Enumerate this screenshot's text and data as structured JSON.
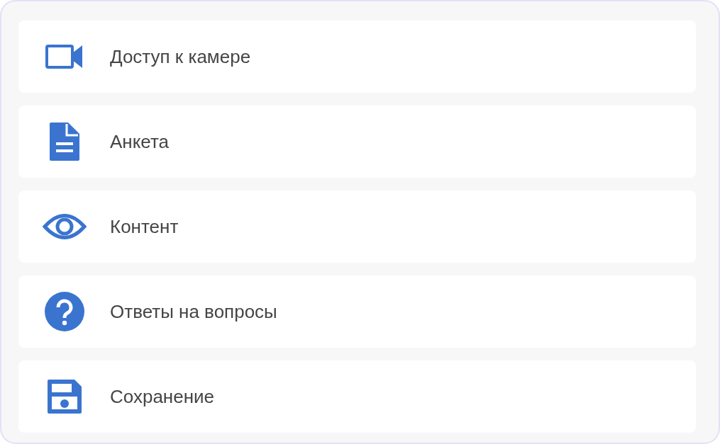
{
  "items": [
    {
      "kind": "camera",
      "label": "Доступ к камере"
    },
    {
      "kind": "document",
      "label": "Анкета"
    },
    {
      "kind": "eye",
      "label": "Контент"
    },
    {
      "kind": "help",
      "label": "Ответы на вопросы"
    },
    {
      "kind": "save",
      "label": "Сохранение"
    }
  ]
}
